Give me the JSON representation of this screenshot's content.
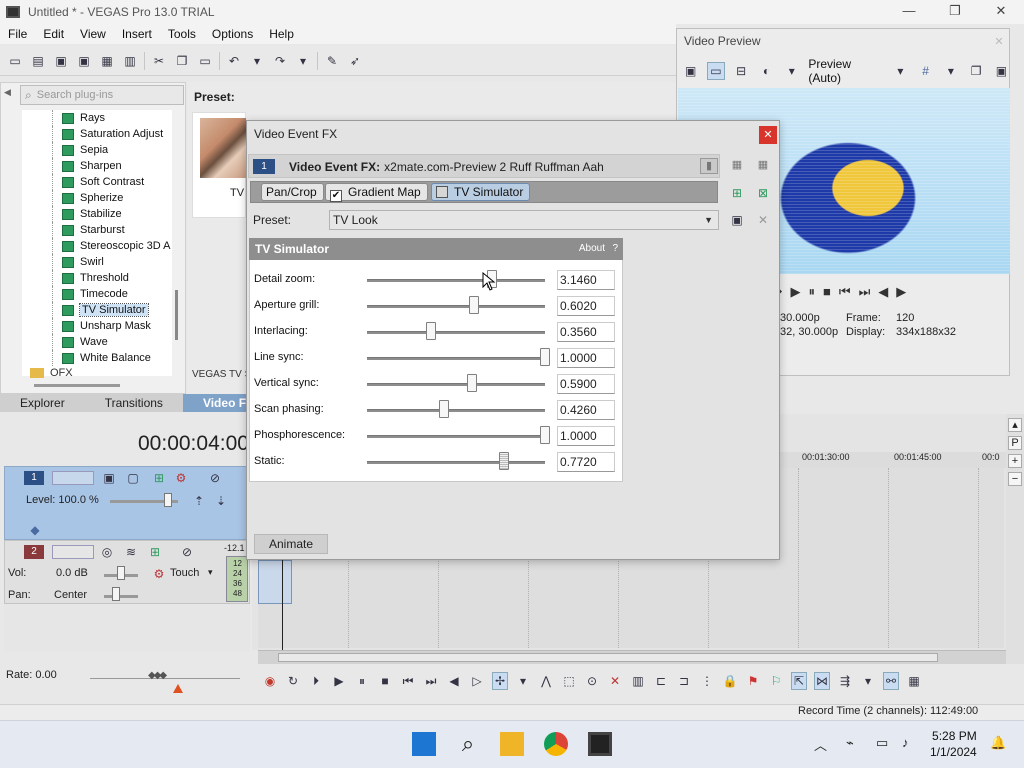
{
  "window": {
    "title": "Untitled * - VEGAS Pro 13.0 TRIAL",
    "minimize": "—",
    "maximize": "❐",
    "close": "✕"
  },
  "menu": [
    "File",
    "Edit",
    "View",
    "Insert",
    "Tools",
    "Options",
    "Help"
  ],
  "plugins": {
    "search_placeholder": "Search plug-ins",
    "items": [
      "Rays",
      "Saturation Adjust",
      "Sepia",
      "Sharpen",
      "Soft Contrast",
      "Spherize",
      "Stabilize",
      "Starburst",
      "Stereoscopic 3D A",
      "Swirl",
      "Threshold",
      "Timecode",
      "TV Simulator",
      "Unsharp Mask",
      "Wave",
      "White Balance"
    ],
    "selected": "TV Simulator",
    "folder": "OFX"
  },
  "preset_panel": {
    "label": "Preset:",
    "thumb_caption": "TV",
    "footer": "VEGAS TV S"
  },
  "tabs": [
    "Explorer",
    "Transitions",
    "Video FX"
  ],
  "active_tab": "Video FX",
  "timeline": {
    "timecode": "00:00:04:00",
    "track1": {
      "number": "1",
      "level_label": "Level: 100.0 %"
    },
    "track2": {
      "number": "2",
      "vol_label": "Vol:",
      "vol_value": "0.0 dB",
      "touch": "Touch",
      "pan_label": "Pan:",
      "pan_value": "Center",
      "meter_top": "-12.1",
      "meter_ticks": [
        "12",
        "24",
        "36",
        "48"
      ]
    },
    "rate_label": "Rate: 0.00",
    "ruler": [
      "00:01:30:00",
      "00:01:45:00",
      "00:0"
    ],
    "record_time": "Record Time (2 channels): 112:49:00"
  },
  "video_preview": {
    "title": "Video Preview",
    "mode": "Preview (Auto)",
    "info": {
      "row1_a": "30.000p",
      "row1_b": "Frame:",
      "row1_c": "120",
      "row2_a": "32, 30.000p",
      "row2_b": "Display:",
      "row2_c": "334x188x32"
    }
  },
  "vefx": {
    "title": "Video Event FX",
    "track_number": "1",
    "header_label": "Video Event FX:",
    "header_value": "x2mate.com-Preview 2 Ruff Ruffman Aah",
    "chain": [
      "Pan/Crop",
      "Gradient Map",
      "TV Simulator"
    ],
    "preset_label": "Preset:",
    "preset_value": "TV Look",
    "panel_title": "TV Simulator",
    "about": "About",
    "help": "?",
    "params": [
      {
        "label": "Detail zoom:",
        "value": "3.1460",
        "level": 0.7
      },
      {
        "label": "Aperture grill:",
        "value": "0.6020",
        "level": 0.6
      },
      {
        "label": "Interlacing:",
        "value": "0.3560",
        "level": 0.36
      },
      {
        "label": "Line sync:",
        "value": "1.0000",
        "level": 1.0
      },
      {
        "label": "Vertical sync:",
        "value": "0.5900",
        "level": 0.59
      },
      {
        "label": "Scan phasing:",
        "value": "0.4260",
        "level": 0.43
      },
      {
        "label": "Phosphorescence:",
        "value": "1.0000",
        "level": 1.0
      },
      {
        "label": "Static:",
        "value": "0.7720",
        "level": 0.77
      }
    ],
    "animate": "Animate"
  },
  "taskbar": {
    "time": "5:28 PM",
    "date": "1/1/2024"
  }
}
